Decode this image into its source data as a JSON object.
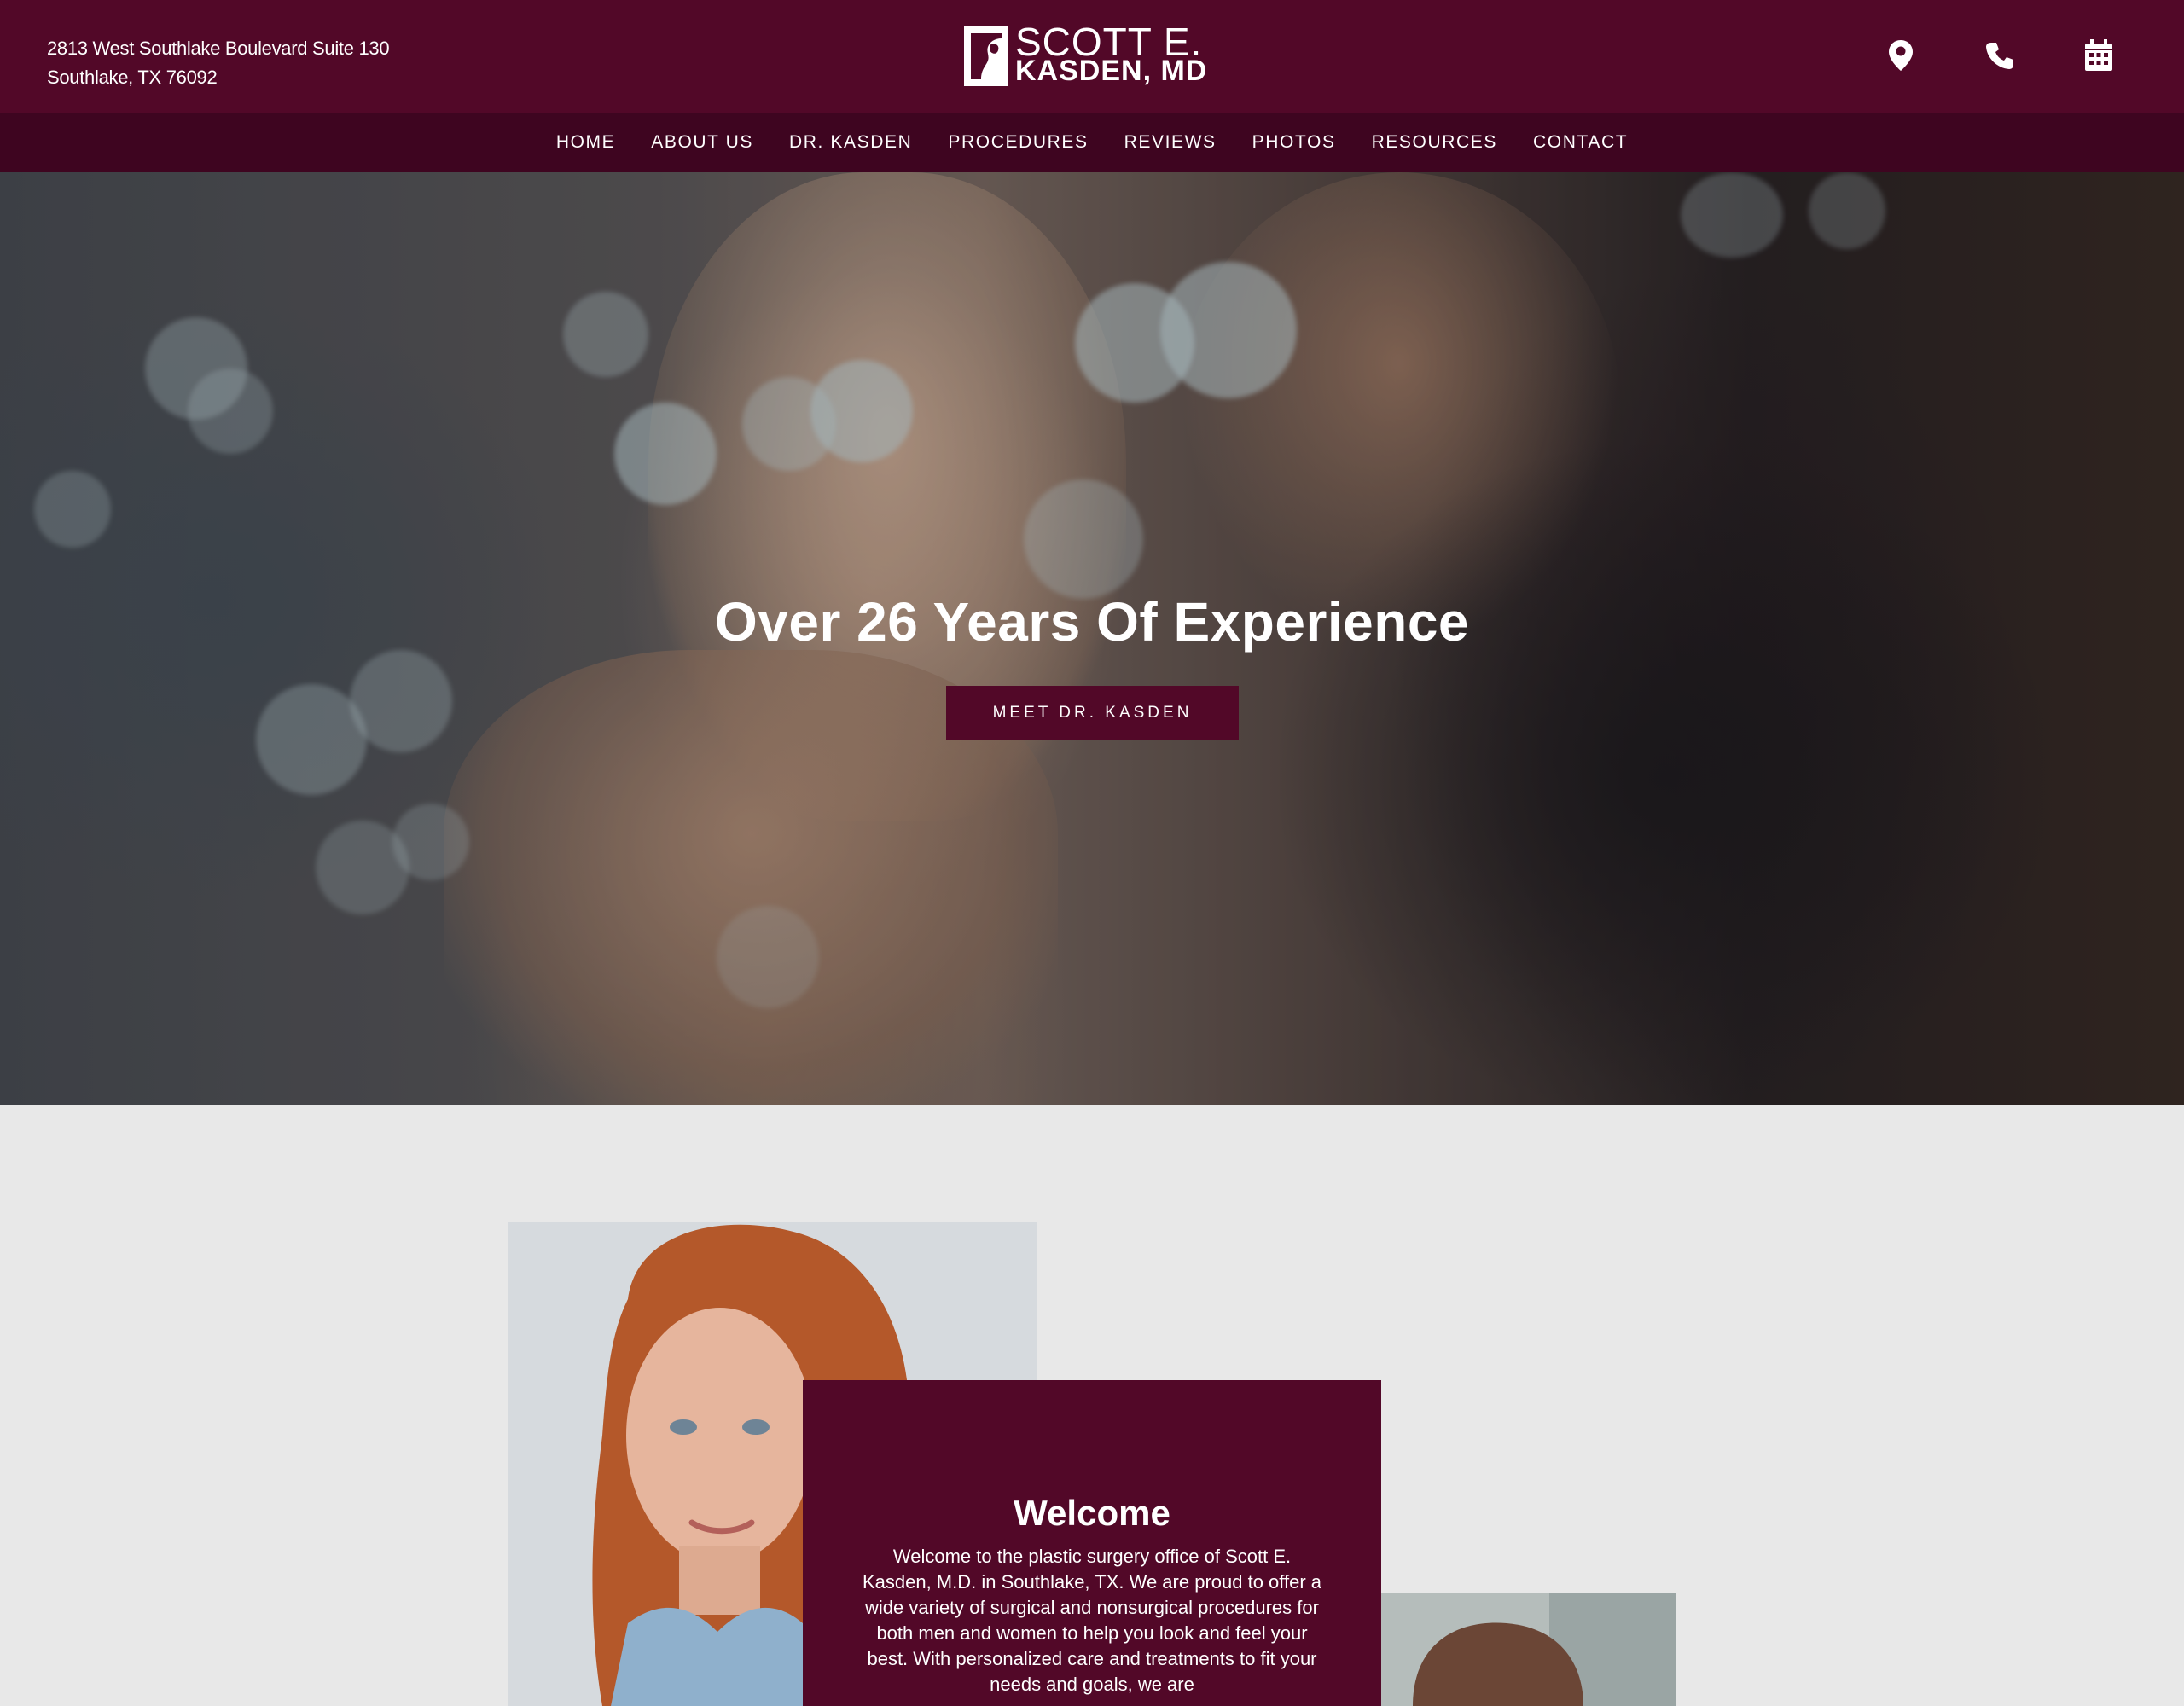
{
  "header": {
    "address_line1": "2813 West Southlake Boulevard Suite 130",
    "address_line2": "Southlake, TX 76092",
    "logo_line1": "SCOTT E.",
    "logo_line2": "KASDEN, MD",
    "icons": [
      "location-pin-icon",
      "phone-icon",
      "calendar-icon"
    ]
  },
  "nav": {
    "items": [
      {
        "label": "HOME"
      },
      {
        "label": "ABOUT US"
      },
      {
        "label": "DR. KASDEN"
      },
      {
        "label": "PROCEDURES"
      },
      {
        "label": "REVIEWS"
      },
      {
        "label": "PHOTOS"
      },
      {
        "label": "RESOURCES"
      },
      {
        "label": "CONTACT"
      }
    ]
  },
  "hero": {
    "title": "Over 26 Years Of Experience",
    "button_label": "MEET DR. KASDEN"
  },
  "welcome": {
    "title": "Welcome",
    "body": "Welcome to the plastic surgery office of Scott E. Kasden, M.D. in Southlake, TX. We are proud to offer a wide variety of surgical and nonsurgical procedures for both men and women to help you look and feel your best. With personalized care and treatments to fit your needs and goals, we are"
  },
  "colors": {
    "brand": "#520828",
    "nav_bg": "#3e0520",
    "section_bg": "#e8e8e8"
  }
}
